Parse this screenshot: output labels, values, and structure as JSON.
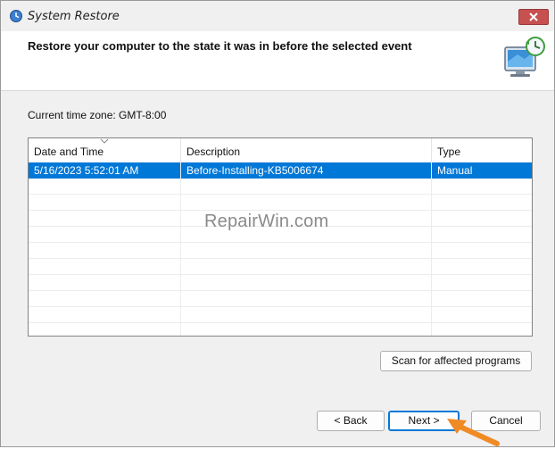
{
  "window": {
    "title": "System Restore",
    "close_icon": "close-icon"
  },
  "header": {
    "instruction": "Restore your computer to the state it was in before the selected event",
    "graphic_icon": "system-restore-monitor-icon"
  },
  "timezone": {
    "label": "Current time zone: GMT-8:00"
  },
  "restore_points": {
    "columns": [
      "Date and Time",
      "Description",
      "Type"
    ],
    "sort_column": "Date and Time",
    "rows": [
      {
        "date_time": "5/16/2023 5:52:01 AM",
        "description": "Before-Installing-KB5006674",
        "type": "Manual",
        "selected": true
      }
    ]
  },
  "watermark": "RepairWin.com",
  "buttons": {
    "scan": "Scan for affected programs",
    "back": "< Back",
    "next": "Next >",
    "cancel": "Cancel"
  },
  "colors": {
    "selection": "#0078d7",
    "annotation_arrow": "#f08a24",
    "close_button": "#c75050"
  }
}
